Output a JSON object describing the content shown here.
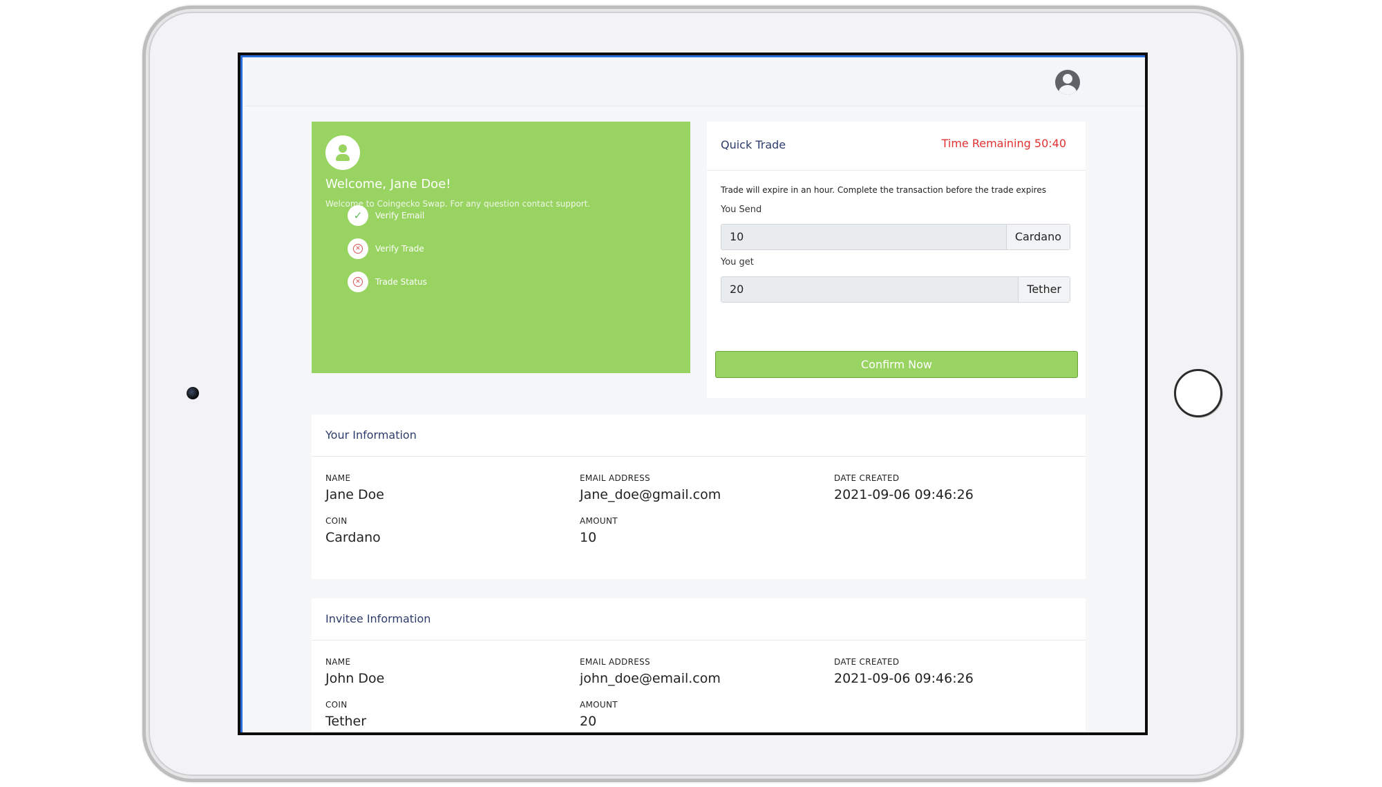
{
  "welcome": {
    "title": "Welcome, Jane Doe!",
    "subtitle": "Welcome to Coingecko Swap. For any question contact support.",
    "steps": [
      {
        "label": "Verify Email",
        "status": "done"
      },
      {
        "label": "Verify Trade",
        "status": "pending"
      },
      {
        "label": "Trade Status",
        "status": "pending"
      }
    ]
  },
  "trade": {
    "title": "Quick Trade",
    "timer": "Time Remaining 50:40",
    "note": "Trade will expire in an hour. Complete the transaction before the trade expires",
    "send_label": "You Send",
    "send_value": "10",
    "send_unit": "Cardano",
    "get_label": "You get",
    "get_value": "20",
    "get_unit": "Tether",
    "confirm_label": "Confirm Now"
  },
  "your_info": {
    "title": "Your Information",
    "name_label": "NAME",
    "name": "Jane Doe",
    "email_label": "EMAIL ADDRESS",
    "email": "Jane_doe@gmail.com",
    "date_label": "DATE CREATED",
    "date": "2021-09-06 09:46:26",
    "coin_label": "COIN",
    "coin": "Cardano",
    "amount_label": "AMOUNT",
    "amount": "10"
  },
  "invitee_info": {
    "title": "Invitee Information",
    "name_label": "NAME",
    "name": "John Doe",
    "email_label": "EMAIL ADDRESS",
    "email": "john_doe@email.com",
    "date_label": "DATE CREATED",
    "date": "2021-09-06 09:46:26",
    "coin_label": "COIN",
    "coin": "Tether",
    "amount_label": "AMOUNT",
    "amount": "20"
  },
  "colors": {
    "accent_green": "#99d462",
    "timer_red": "#e03131",
    "title_blue": "#2d3c6b"
  }
}
